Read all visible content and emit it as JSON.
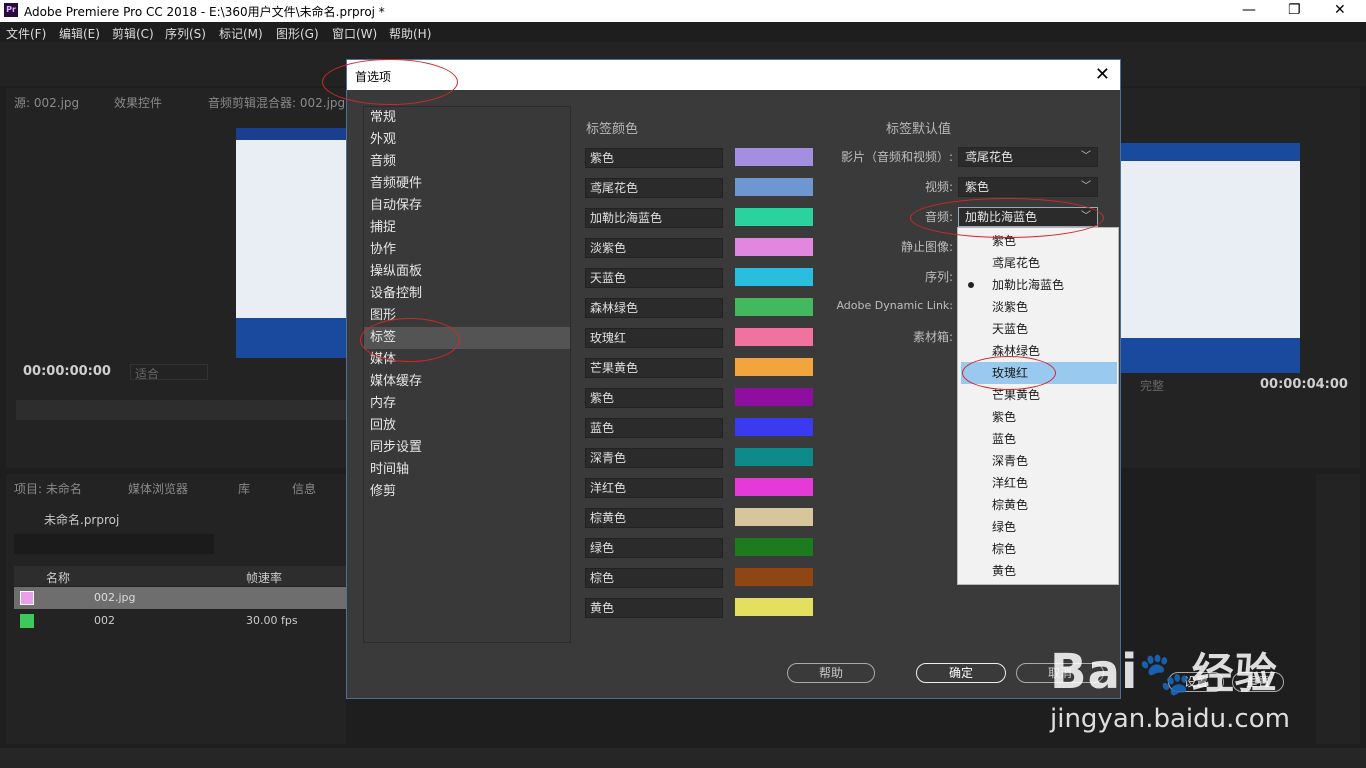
{
  "window": {
    "title": "Adobe Premiere Pro CC 2018 - E:\\360用户文件\\未命名.prproj *",
    "logo": "Pr"
  },
  "menu": [
    "文件(F)",
    "编辑(E)",
    "剪辑(C)",
    "序列(S)",
    "标记(M)",
    "图形(G)",
    "窗口(W)",
    "帮助(H)"
  ],
  "source_panel": {
    "tabs": [
      "源: 002.jpg",
      "效果控件",
      "音频剪辑混合器: 002.jpg"
    ],
    "timecode": "00:00:00:00",
    "fit": "适合"
  },
  "program_panel": {
    "timecode": "00:00:04:00",
    "quality": "完整"
  },
  "project_panel": {
    "tabs": [
      "项目: 未命名",
      "媒体浏览器",
      "库",
      "信息"
    ],
    "project_name": "未命名.prproj",
    "col_name": "名称",
    "col_fps": "帧速率",
    "rows": [
      {
        "name": "002.jpg",
        "fps": "",
        "color": "#e8a0e8"
      },
      {
        "name": "002",
        "fps": "30.00 fps",
        "color": "#3cc85a"
      }
    ]
  },
  "dialog": {
    "title": "首选项",
    "categories": [
      "常规",
      "外观",
      "音频",
      "音频硬件",
      "自动保存",
      "捕捉",
      "协作",
      "操纵面板",
      "设备控制",
      "图形",
      "标签",
      "媒体",
      "媒体缓存",
      "内存",
      "回放",
      "同步设置",
      "时间轴",
      "修剪"
    ],
    "selected_category": "标签",
    "label_colors_title": "标签颜色",
    "label_defaults_title": "标签默认值",
    "labels": [
      {
        "name": "紫色",
        "color": "#a48ee0"
      },
      {
        "name": "鸢尾花色",
        "color": "#6e96d0"
      },
      {
        "name": "加勒比海蓝色",
        "color": "#2ad39e"
      },
      {
        "name": "淡紫色",
        "color": "#e287e0"
      },
      {
        "name": "天蓝色",
        "color": "#2bbde0"
      },
      {
        "name": "森林绿色",
        "color": "#44b85e"
      },
      {
        "name": "玫瑰红",
        "color": "#f0729e"
      },
      {
        "name": "芒果黄色",
        "color": "#f2a53c"
      },
      {
        "name": "紫色",
        "color": "#8e0ea0"
      },
      {
        "name": "蓝色",
        "color": "#3a3af0"
      },
      {
        "name": "深青色",
        "color": "#0e8a8a"
      },
      {
        "name": "洋红色",
        "color": "#e33ad8"
      },
      {
        "name": "棕黄色",
        "color": "#d7c59c"
      },
      {
        "name": "绿色",
        "color": "#1e7a1e"
      },
      {
        "name": "棕色",
        "color": "#8e4614"
      },
      {
        "name": "黄色",
        "color": "#e2e05e"
      }
    ],
    "defaults": [
      {
        "label": "影片（音频和视频）:",
        "value": "鸢尾花色"
      },
      {
        "label": "视频:",
        "value": "紫色"
      },
      {
        "label": "音频:",
        "value": "加勒比海蓝色"
      },
      {
        "label": "静止图像:",
        "value": ""
      },
      {
        "label": "序列:",
        "value": ""
      },
      {
        "label": "Adobe Dynamic Link:",
        "value": ""
      },
      {
        "label": "素材箱:",
        "value": ""
      }
    ],
    "dropdown_options": [
      "紫色",
      "鸢尾花色",
      "加勒比海蓝色",
      "淡紫色",
      "天蓝色",
      "森林绿色",
      "玫瑰红",
      "芒果黄色",
      "紫色",
      "蓝色",
      "深青色",
      "洋红色",
      "棕黄色",
      "绿色",
      "棕色",
      "黄色"
    ],
    "dropdown_checked": "加勒比海蓝色",
    "dropdown_highlight": "玫瑰红",
    "buttons": {
      "help": "帮助",
      "ok": "确定",
      "cancel": "取消"
    }
  },
  "bottom_right": {
    "settings": "设置",
    "reset": "重置"
  },
  "watermark": {
    "brand": "Bai",
    "suffix": "经验",
    "url": "jingyan.baidu.com"
  }
}
